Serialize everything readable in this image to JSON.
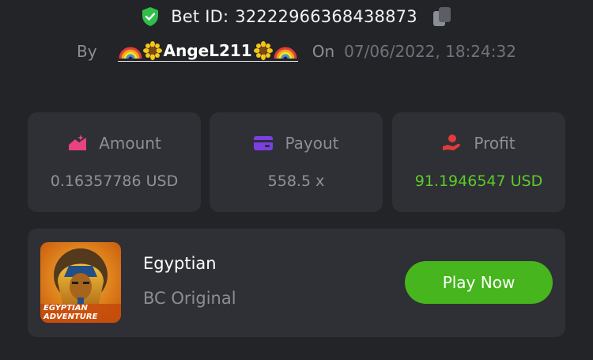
{
  "header": {
    "bet_id_label": "Bet ID:",
    "bet_id_value": "32222966368438873",
    "icons": [
      "shield-check-icon",
      "copy-icon"
    ]
  },
  "author": {
    "by_label": "By",
    "username": "AngeL211",
    "username_decorations": [
      "rainbow",
      "sunflower",
      "sunflower",
      "rainbow"
    ],
    "on_label": "On",
    "datetime": "07/06/2022, 18:24:32"
  },
  "stats": [
    {
      "label": "Amount",
      "value": "0.16357786 USD",
      "icon": "amount-icon",
      "icon_color": "#e8437e"
    },
    {
      "label": "Payout",
      "value": "558.5 x",
      "icon": "wallet-icon",
      "icon_color": "#7b3fe4"
    },
    {
      "label": "Profit",
      "value": "91.1946547 USD",
      "icon": "profit-hand-icon",
      "icon_color": "#e23b3b",
      "value_color": "#5dcb2a"
    }
  ],
  "game": {
    "title": "Egyptian",
    "subtitle": "BC Original",
    "thumbnail_text": "EGYPTIAN ADVENTURE",
    "play_label": "Play Now"
  },
  "colors": {
    "background": "#232428",
    "card": "#2e3035",
    "accent_green": "#47b51e",
    "profit_green": "#5dcb2a"
  }
}
